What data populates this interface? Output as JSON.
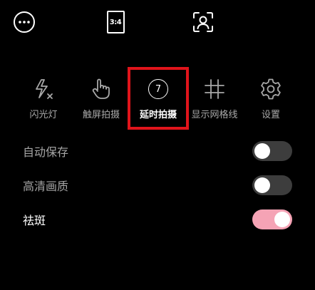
{
  "top_bar": {
    "aspect_ratio_label": "3:4",
    "icons": [
      "more-icon",
      "aspect-ratio-icon",
      "face-focus-icon"
    ]
  },
  "tools": [
    {
      "label": "闪光灯",
      "icon": "flash-off-icon"
    },
    {
      "label": "触屏拍摄",
      "icon": "touch-capture-icon"
    },
    {
      "label": "延时拍摄",
      "icon": "timer-icon",
      "timer_value": "7",
      "active": true
    },
    {
      "label": "显示网格线",
      "icon": "grid-icon"
    },
    {
      "label": "设置",
      "icon": "gear-icon"
    }
  ],
  "settings": [
    {
      "label": "自动保存",
      "enabled": false
    },
    {
      "label": "高清画质",
      "enabled": false
    },
    {
      "label": "祛斑",
      "enabled": true
    }
  ],
  "colors": {
    "background": "#000000",
    "highlight_border": "#e0141b",
    "toggle_on": "#f5a3b5",
    "toggle_off": "#3d3d3d"
  }
}
